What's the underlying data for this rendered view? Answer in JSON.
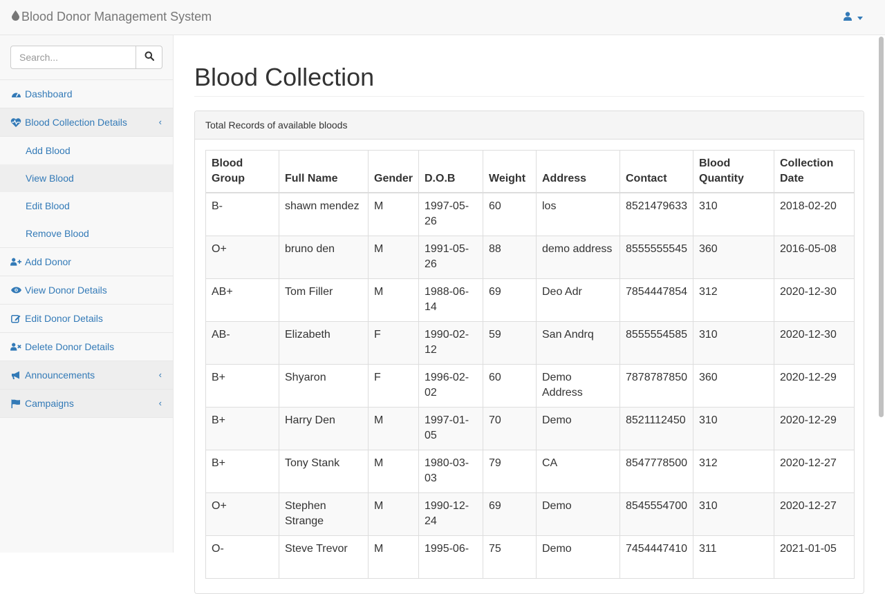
{
  "navbar": {
    "brand": "Blood Donor Management System",
    "brand_icon": "blood-drop-icon",
    "user_icon": "user-icon"
  },
  "sidebar": {
    "search": {
      "placeholder": "Search...",
      "value": ""
    },
    "items": [
      {
        "label": "Dashboard",
        "icon": "dashboard-icon"
      },
      {
        "label": "Blood Collection Details",
        "icon": "heartbeat-icon",
        "children": [
          "Add Blood",
          "View Blood",
          "Edit Blood",
          "Remove Blood"
        ]
      },
      {
        "label": "Add Donor",
        "icon": "user-plus-icon"
      },
      {
        "label": "View Donor Details",
        "icon": "eye-icon"
      },
      {
        "label": "Edit Donor Details",
        "icon": "edit-icon"
      },
      {
        "label": "Delete Donor Details",
        "icon": "user-times-icon"
      },
      {
        "label": "Announcements",
        "icon": "bullhorn-icon"
      },
      {
        "label": "Campaigns",
        "icon": "flag-icon"
      }
    ]
  },
  "main": {
    "title": "Blood Collection",
    "panel_heading": "Total Records of available bloods",
    "table": {
      "columns": [
        "Blood Group",
        "Full Name",
        "Gender",
        "D.O.B",
        "Weight",
        "Address",
        "Contact",
        "Blood Quantity",
        "Collection Date"
      ],
      "rows": [
        [
          "B-",
          "shawn mendez",
          "M",
          "1997-05-26",
          "60",
          "los",
          "8521479633",
          "310",
          "2018-02-20"
        ],
        [
          "O+",
          "bruno den",
          "M",
          "1991-05-26",
          "88",
          "demo address",
          "8555555545",
          "360",
          "2016-05-08"
        ],
        [
          "AB+",
          "Tom Filler",
          "M",
          "1988-06-14",
          "69",
          "Deo Adr",
          "7854447854",
          "312",
          "2020-12-30"
        ],
        [
          "AB-",
          "Elizabeth",
          "F",
          "1990-02-12",
          "59",
          "San Andrq",
          "8555554585",
          "310",
          "2020-12-30"
        ],
        [
          "B+",
          "Shyaron",
          "F",
          "1996-02-02",
          "60",
          "Demo Address",
          "7878787850",
          "360",
          "2020-12-29"
        ],
        [
          "B+",
          "Harry Den",
          "M",
          "1997-01-05",
          "70",
          "Demo",
          "8521112450",
          "310",
          "2020-12-29"
        ],
        [
          "B+",
          "Tony Stank",
          "M",
          "1980-03-03",
          "79",
          "CA",
          "8547778500",
          "312",
          "2020-12-27"
        ],
        [
          "O+",
          "Stephen Strange",
          "M",
          "1990-12-24",
          "69",
          "Demo",
          "8545554700",
          "310",
          "2020-12-27"
        ],
        [
          "O-",
          "Steve Trevor",
          "M",
          "1995-06-",
          "75",
          "Demo",
          "7454447410",
          "311",
          "2021-01-05"
        ]
      ]
    }
  },
  "colors": {
    "link": "#337ab7",
    "navbar_bg": "#f8f8f8",
    "border": "#e7e7e7"
  }
}
